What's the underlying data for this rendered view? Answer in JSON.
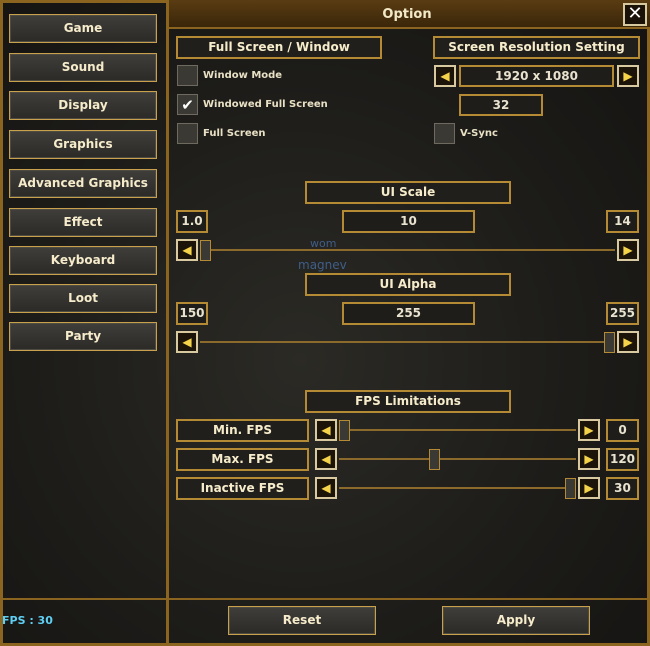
{
  "window": {
    "title": "Option"
  },
  "sidebar": {
    "items": [
      {
        "label": "Game"
      },
      {
        "label": "Sound"
      },
      {
        "label": "Display"
      },
      {
        "label": "Graphics"
      },
      {
        "label": "Advanced Graphics"
      },
      {
        "label": "Effect"
      },
      {
        "label": "Keyboard"
      },
      {
        "label": "Loot"
      },
      {
        "label": "Party"
      }
    ]
  },
  "display": {
    "screen_mode_header": "Full Screen / Window",
    "resolution_header": "Screen Resolution Setting",
    "window_mode": {
      "label": "Window Mode",
      "checked": false
    },
    "windowed_full_screen": {
      "label": "Windowed Full Screen",
      "checked": true
    },
    "full_screen": {
      "label": "Full Screen",
      "checked": false
    },
    "resolution": "1920 x 1080",
    "color_depth": "32",
    "vsync": {
      "label": "V-Sync",
      "checked": false
    }
  },
  "ui_scale": {
    "header": "UI Scale",
    "min": "1.0",
    "current": "10",
    "max": "14",
    "level": 0.0
  },
  "ui_alpha": {
    "header": "UI Alpha",
    "min": "150",
    "current": "255",
    "max": "255",
    "level": 1.0
  },
  "fps": {
    "header": "FPS Limitations",
    "rows": [
      {
        "label": "Min. FPS",
        "value": "0",
        "level": 0.0
      },
      {
        "label": "Max. FPS",
        "value": "120",
        "level": 0.4
      },
      {
        "label": "Inactive FPS",
        "value": "30",
        "level": 1.0
      }
    ]
  },
  "footer": {
    "reset": "Reset",
    "apply": "Apply",
    "fps_readout": "FPS : 30"
  },
  "background_text": [
    "wom",
    "magnev"
  ],
  "icons": {
    "close": "close-icon",
    "arrow_left": "arrow-left-icon",
    "arrow_right": "arrow-right-icon",
    "check": "checkmark-icon"
  }
}
